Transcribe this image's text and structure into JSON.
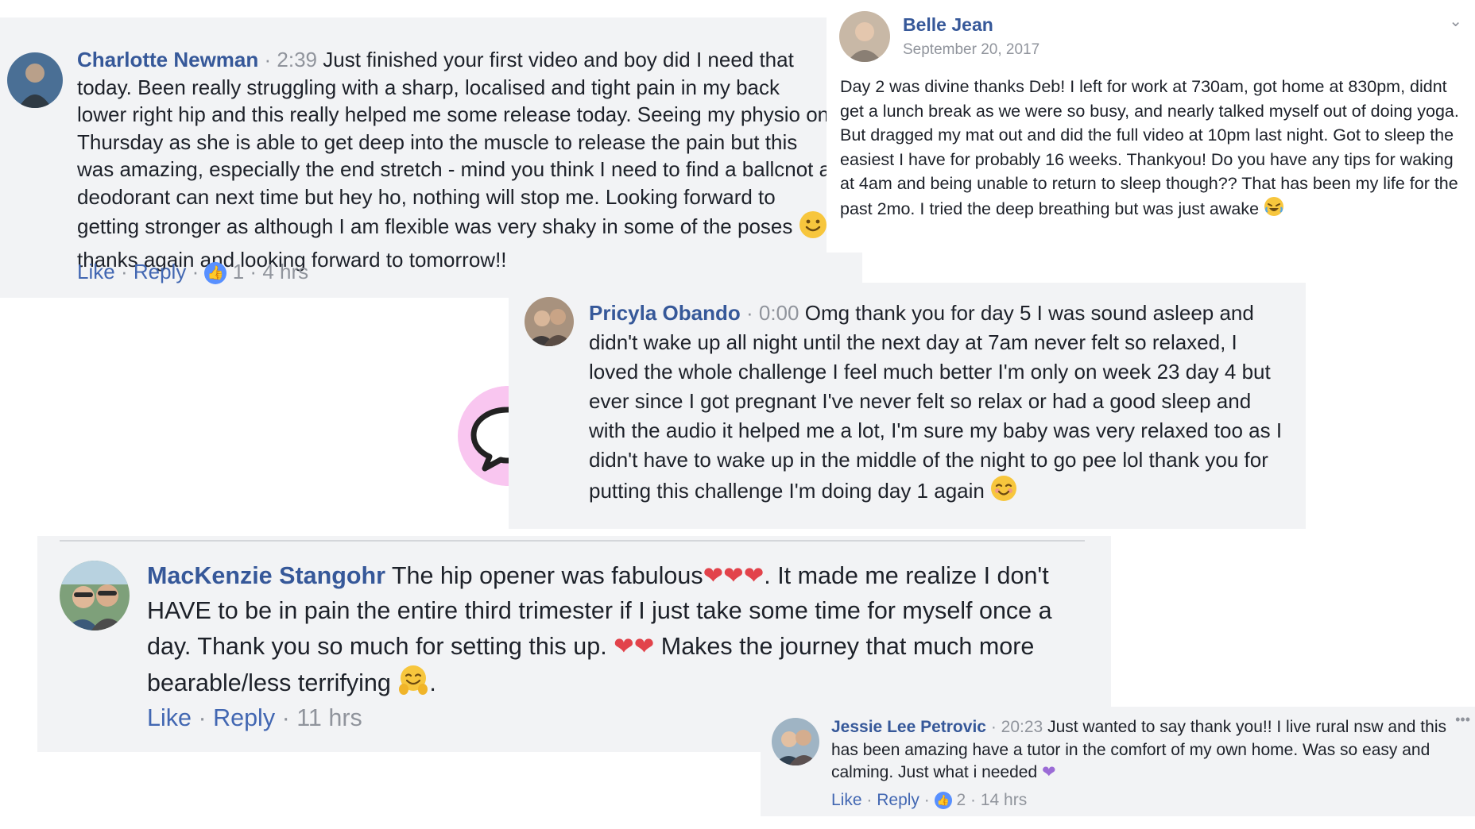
{
  "charlotte": {
    "name": "Charlotte Newman",
    "time": "2:39",
    "body_1": "Just finished your first video and boy did I need that today. Been really struggling with a sharp, localised and tight pain in my back lower right hip and this really helped me some release today. Seeing my physio on Thursday as she is able to get deep into the muscle to release the pain but this was amazing, especially the end stretch - mind you think I need to find a ballcnot a deodorant can next time but hey ho, nothing will stop me. Looking forward to getting stronger as although I am flexible was very shaky in some of the poses",
    "body_2": "thanks again and looking forward to tomorrow!!",
    "like": "Like",
    "reply": "Reply",
    "reactions": "1",
    "age": "4 hrs"
  },
  "belle": {
    "name": "Belle Jean",
    "date": "September 20, 2017",
    "body": "Day 2 was divine thanks Deb! I left for work at 730am, got home at 830pm, didnt get a lunch break as we were so busy, and nearly talked myself out of doing yoga. But dragged my mat out and did the full video at 10pm last night. Got to sleep the easiest I have for probably 16 weeks. Thankyou! Do you have any tips for waking at 4am and being unable to return to sleep though?? That has been my life for the past 2mo. I tried the deep breathing but was just awake"
  },
  "pricyla": {
    "name": "Pricyla Obando",
    "time": "0:00",
    "body": "Omg thank you for day 5 I was sound asleep and didn't wake up all night until the next day at 7am never felt so relaxed, I loved the whole challenge I feel much better I'm only on week 23 day 4 but ever since I got pregnant I've never felt so relax or had a good sleep and with the audio it helped me a lot, I'm sure my baby was very relaxed too as I didn't have to wake up in the middle of the night to go pee lol thank you for putting this challenge I'm doing day 1 again"
  },
  "mackenzie": {
    "name": "MacKenzie Stangohr",
    "body_1": "The hip opener was fabulous",
    "body_2": ". It made me realize I don't HAVE to be in pain the entire third trimester if I just take some time for myself once a day. Thank you so much for setting this up.",
    "body_3": "Makes the journey that much more bearable/less terrifying",
    "body_4": ".",
    "like": "Like",
    "reply": "Reply",
    "age": "11 hrs"
  },
  "jessie": {
    "name": "Jessie Lee Petrovic",
    "time": "20:23",
    "body": "Just wanted to say thank you!! I live rural nsw and this has been amazing have a tutor in the comfort of my own home. Was so easy and calming. Just what i needed",
    "like": "Like",
    "reply": "Reply",
    "reactions": "2",
    "age": "14 hrs"
  },
  "colors": {
    "name_blue": "#365899",
    "link_blue": "#4267b2",
    "muted_grey": "#90949c",
    "card_grey": "#f2f3f5",
    "heart_red": "#e2434b",
    "bubble_pink": "#f9c6f0"
  }
}
